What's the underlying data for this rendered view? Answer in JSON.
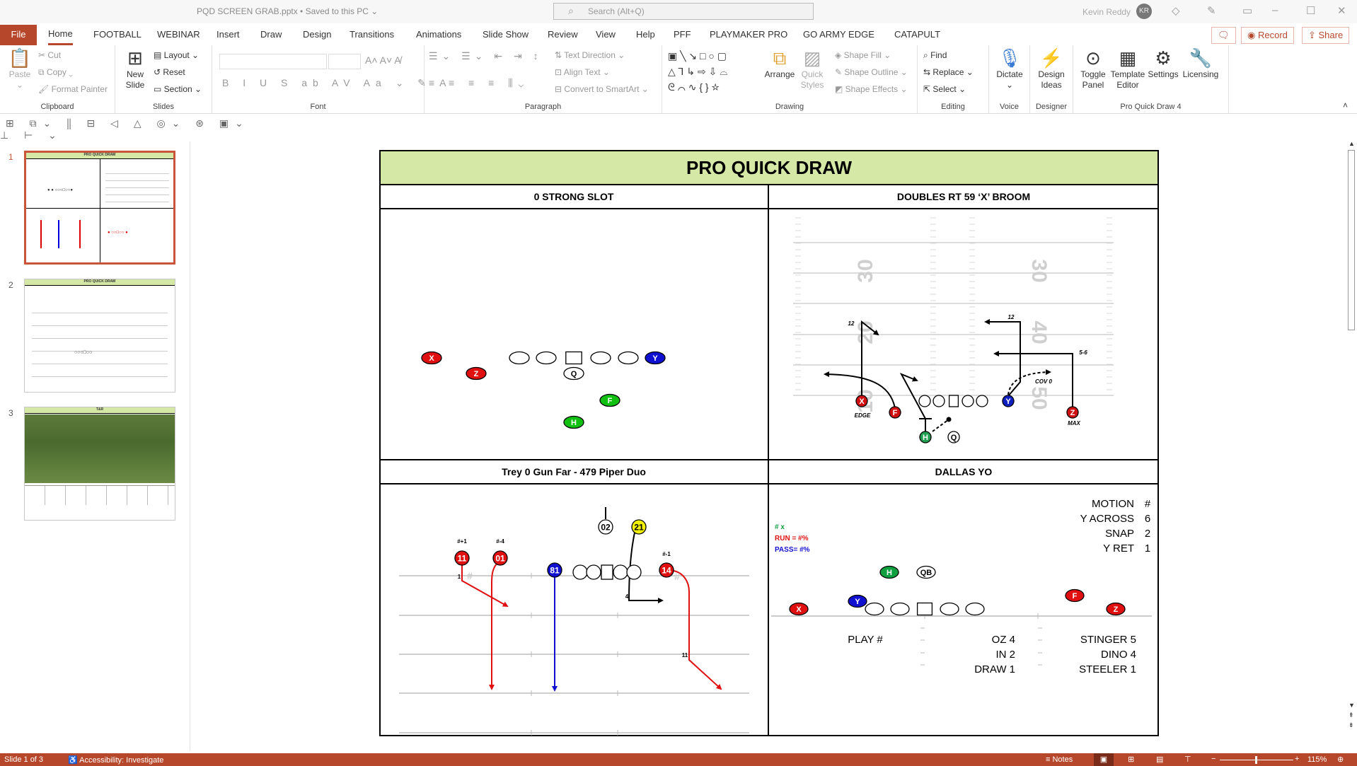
{
  "window": {
    "title": "PQD SCREEN GRAB.pptx • Saved to this PC ⌄",
    "search_placeholder": "Search (Alt+Q)",
    "user_name": "Kevin Reddy",
    "user_initials": "KR"
  },
  "tabs": [
    "File",
    "Home",
    "FOOTBALL",
    "WEBINAR",
    "Insert",
    "Draw",
    "Design",
    "Transitions",
    "Animations",
    "Slide Show",
    "Review",
    "View",
    "Help",
    "PFF",
    "PLAYMAKER PRO",
    "GO ARMY EDGE",
    "CATAPULT"
  ],
  "active_tab": "Home",
  "actions": {
    "record": "Record",
    "share": "Share"
  },
  "ribbon": {
    "clipboard": {
      "label": "Clipboard",
      "paste": "Paste",
      "cut": "Cut",
      "copy": "Copy",
      "format_painter": "Format Painter"
    },
    "slides": {
      "label": "Slides",
      "new_slide": "New Slide",
      "layout": "Layout",
      "reset": "Reset",
      "section": "Section"
    },
    "font": {
      "label": "Font"
    },
    "paragraph": {
      "label": "Paragraph",
      "text_direction": "Text Direction",
      "align_text": "Align Text",
      "convert": "Convert to SmartArt"
    },
    "drawing": {
      "label": "Drawing",
      "arrange": "Arrange",
      "quick_styles": "Quick Styles",
      "shape_fill": "Shape Fill",
      "shape_outline": "Shape Outline",
      "shape_effects": "Shape Effects"
    },
    "editing": {
      "label": "Editing",
      "find": "Find",
      "replace": "Replace",
      "select": "Select"
    },
    "voice": {
      "label": "Voice",
      "dictate": "Dictate"
    },
    "designer": {
      "label": "Designer",
      "design_ideas": "Design Ideas"
    },
    "pqd": {
      "label": "Pro Quick Draw 4",
      "toggle_panel": "Toggle Panel",
      "template_editor": "Template Editor",
      "settings": "Settings",
      "licensing": "Licensing"
    }
  },
  "thumbnails": [
    {
      "number": "1",
      "title": "PRO QUICK DRAW"
    },
    {
      "number": "2",
      "title": "PRO QUICK DRAW"
    },
    {
      "number": "3",
      "title": "T&R"
    }
  ],
  "slide": {
    "title": "PRO QUICK DRAW",
    "title_bg": "#d6e8a6",
    "q1": {
      "header": "0 STRONG SLOT",
      "players": [
        {
          "label": "X",
          "color": "#e01010"
        },
        {
          "label": "Z",
          "color": "#e01010"
        },
        {
          "label": "",
          "color": "#ffffff"
        },
        {
          "label": "",
          "color": "#ffffff"
        },
        {
          "label": "",
          "color": "#ffffff",
          "shape": "square"
        },
        {
          "label": "",
          "color": "#ffffff"
        },
        {
          "label": "",
          "color": "#ffffff"
        },
        {
          "label": "Y",
          "color": "#1010d0"
        },
        {
          "label": "Q",
          "color": "#ffffff"
        },
        {
          "label": "F",
          "color": "#10c010"
        },
        {
          "label": "H",
          "color": "#10c010"
        }
      ]
    },
    "q2": {
      "header": "DOUBLES RT 59 ‘X’ BROOM",
      "field_numbers": [
        "30",
        "20",
        "10",
        "30",
        "40",
        "50"
      ],
      "players": [
        {
          "label": "X",
          "color": "#d01010"
        },
        {
          "label": "F",
          "color": "#d01010"
        },
        {
          "label": "",
          "color": "#ffffff"
        },
        {
          "label": "",
          "color": "#ffffff"
        },
        {
          "label": "",
          "color": "#ffffff",
          "shape": "square"
        },
        {
          "label": "",
          "color": "#ffffff"
        },
        {
          "label": "",
          "color": "#ffffff"
        },
        {
          "label": "Y",
          "color": "#1020c0"
        },
        {
          "label": "Z",
          "color": "#d01010"
        },
        {
          "label": "H",
          "color": "#20a050"
        },
        {
          "label": "Q",
          "color": "#ffffff"
        }
      ],
      "labels": [
        "EDGE",
        "MAX",
        "12",
        "12",
        "5-6",
        "COV 0"
      ]
    },
    "q3": {
      "header": "Trey 0 Gun Far - 479 Piper Duo",
      "players": [
        {
          "label": "11",
          "color": "#e01010"
        },
        {
          "label": "01",
          "color": "#e01010"
        },
        {
          "label": "81",
          "color": "#1010d0"
        },
        {
          "label": "",
          "color": "#ffffff"
        },
        {
          "label": "",
          "color": "#ffffff"
        },
        {
          "label": "",
          "color": "#ffffff",
          "shape": "square"
        },
        {
          "label": "",
          "color": "#ffffff"
        },
        {
          "label": "",
          "color": "#ffffff"
        },
        {
          "label": "02",
          "color": "#ffffff"
        },
        {
          "label": "21",
          "color": "#f0f000"
        },
        {
          "label": "14",
          "color": "#e01010"
        }
      ],
      "labels": [
        "#+1",
        "#-4",
        "#-1",
        "1",
        "4",
        "11",
        "#",
        "#"
      ]
    },
    "q4": {
      "header": "DALLAS YO",
      "legend": [
        {
          "text": "#  x",
          "color": "#10a040"
        },
        {
          "text": "RUN =  #%",
          "color": "#e01010"
        },
        {
          "text": "PASS= #%",
          "color": "#1010d0"
        }
      ],
      "counts": [
        {
          "label": "MOTION",
          "value": "#"
        },
        {
          "label": "Y ACROSS",
          "value": "6"
        },
        {
          "label": "SNAP",
          "value": "2"
        },
        {
          "label": "Y RET",
          "value": "1"
        }
      ],
      "players": [
        {
          "label": "H",
          "color": "#10a040"
        },
        {
          "label": "QB",
          "color": "#ffffff"
        },
        {
          "label": "Y",
          "color": "#1010d0"
        },
        {
          "label": "X",
          "color": "#e01010"
        },
        {
          "label": "",
          "color": "#ffffff"
        },
        {
          "label": "",
          "color": "#ffffff"
        },
        {
          "label": "",
          "color": "#ffffff",
          "shape": "square"
        },
        {
          "label": "",
          "color": "#ffffff"
        },
        {
          "label": "",
          "color": "#ffffff"
        },
        {
          "label": "F",
          "color": "#e01010"
        },
        {
          "label": "Z",
          "color": "#e01010"
        }
      ],
      "play_label": "PLAY #",
      "plays_mid": [
        "OZ 4",
        "IN 2",
        "DRAW 1"
      ],
      "plays_right": [
        "STINGER 5",
        "DINO 4",
        "STEELER 1"
      ]
    }
  },
  "status": {
    "slide": "Slide 1 of 3",
    "accessibility": "Accessibility: Investigate",
    "notes": "Notes",
    "zoom": "115%"
  },
  "colors": {
    "accent": "#b7472a"
  }
}
